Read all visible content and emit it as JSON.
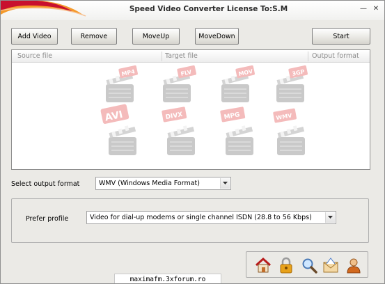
{
  "window": {
    "title": "Speed Video Converter License To:S.M",
    "minimize_glyph": "—",
    "close_glyph": "✕"
  },
  "toolbar": {
    "add_video": "Add Video",
    "remove": "Remove",
    "move_up": "MoveUp",
    "move_down": "MoveDown",
    "start": "Start"
  },
  "file_list": {
    "columns": [
      "Source file",
      "Target file",
      "Output format"
    ],
    "rows": [],
    "watermark_badges": [
      "MP4",
      "FLV",
      "MOV",
      "3GP",
      "AVI",
      "DIVX",
      "MPG",
      "WMV"
    ]
  },
  "output_format": {
    "label": "Select output format",
    "selected": "WMV (Windows Media Format)"
  },
  "profile": {
    "label": "Prefer profile",
    "selected": "Video for dial-up modems or single channel ISDN (28.8 to 56 Kbps)"
  },
  "bottom_icons": [
    "home-icon",
    "lock-icon",
    "magnifier-icon",
    "email-icon",
    "user-icon"
  ],
  "taskbar": {
    "text": "maximafm.3xforum.ro"
  },
  "colors": {
    "window_bg": "#ebeae6",
    "title_swoosh_red": "#c8102e",
    "title_swoosh_orange": "#f59a2b",
    "watermark_red": "#e02f2f"
  }
}
